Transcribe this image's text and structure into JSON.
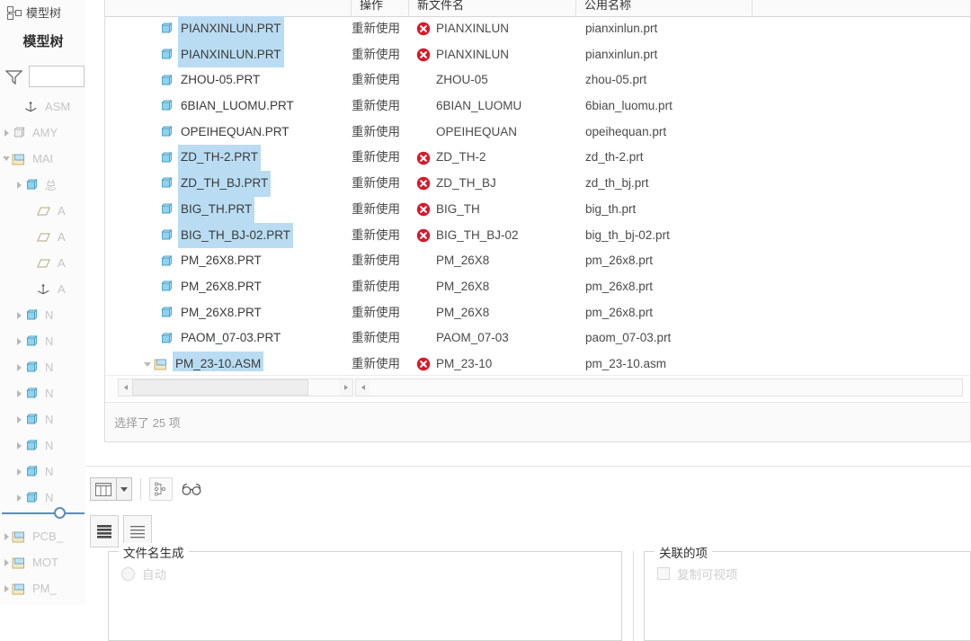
{
  "left_panel": {
    "tab_label": "模型树",
    "panel_title": "模型树",
    "filter_placeholder": "",
    "filter_value": "",
    "filter_icon": "funnel-icon",
    "tree_items": [
      {
        "label": "ASM",
        "icon": "csys-icon",
        "indent": 2,
        "toggle": "none"
      },
      {
        "label": "AMY",
        "icon": "part-grey-icon",
        "indent": 1,
        "toggle": "right"
      },
      {
        "label": "MAI",
        "icon": "assembly-icon",
        "indent": 1,
        "toggle": "down"
      },
      {
        "label": "总",
        "icon": "assembly-blue-icon",
        "indent": 2,
        "toggle": "right"
      },
      {
        "label": "A",
        "icon": "plane-icon",
        "indent": 3,
        "toggle": "none"
      },
      {
        "label": "A",
        "icon": "plane-icon",
        "indent": 3,
        "toggle": "none"
      },
      {
        "label": "A",
        "icon": "plane-icon",
        "indent": 3,
        "toggle": "none"
      },
      {
        "label": "A",
        "icon": "csys-icon",
        "indent": 3,
        "toggle": "none"
      },
      {
        "label": "N",
        "icon": "part-blue-icon",
        "indent": 2,
        "toggle": "right"
      },
      {
        "label": "N",
        "icon": "part-blue-icon",
        "indent": 2,
        "toggle": "right"
      },
      {
        "label": "N",
        "icon": "part-blue-icon",
        "indent": 2,
        "toggle": "right"
      },
      {
        "label": "N",
        "icon": "part-blue-icon",
        "indent": 2,
        "toggle": "right"
      },
      {
        "label": "N",
        "icon": "part-blue-icon",
        "indent": 2,
        "toggle": "right"
      },
      {
        "label": "N",
        "icon": "part-blue-icon",
        "indent": 2,
        "toggle": "right"
      },
      {
        "label": "N",
        "icon": "part-blue-icon",
        "indent": 2,
        "toggle": "right"
      },
      {
        "label": "N",
        "icon": "part-blue-icon",
        "indent": 2,
        "toggle": "right"
      }
    ],
    "tree_items_below": [
      {
        "label": "PCB_",
        "icon": "assembly-icon",
        "indent": 1,
        "toggle": "right"
      },
      {
        "label": "MOT",
        "icon": "assembly-icon",
        "indent": 1,
        "toggle": "right"
      },
      {
        "label": "PM_",
        "icon": "assembly-icon",
        "indent": 1,
        "toggle": "right"
      }
    ]
  },
  "table": {
    "columns": [
      {
        "key": "file",
        "label": ""
      },
      {
        "key": "op",
        "label": "操作"
      },
      {
        "key": "newname",
        "label": "新文件名"
      },
      {
        "key": "pubname",
        "label": "公用名称"
      }
    ],
    "rows": [
      {
        "file": "PIANXINLUN.PRT",
        "icon": "part-icon",
        "selected": true,
        "op": "重新使用",
        "newname": "PIANXINLUN",
        "error": true,
        "pubname": "pianxinlun.prt",
        "expand": ""
      },
      {
        "file": "PIANXINLUN.PRT",
        "icon": "part-icon",
        "selected": true,
        "op": "重新使用",
        "newname": "PIANXINLUN",
        "error": true,
        "pubname": "pianxinlun.prt",
        "expand": ""
      },
      {
        "file": "ZHOU-05.PRT",
        "icon": "part-icon",
        "selected": false,
        "op": "重新使用",
        "newname": "ZHOU-05",
        "error": false,
        "pubname": "zhou-05.prt",
        "expand": ""
      },
      {
        "file": "6BIAN_LUOMU.PRT",
        "icon": "part-icon",
        "selected": false,
        "op": "重新使用",
        "newname": "6BIAN_LUOMU",
        "error": false,
        "pubname": "6bian_luomu.prt",
        "expand": ""
      },
      {
        "file": "OPEIHEQUAN.PRT",
        "icon": "part-icon",
        "selected": false,
        "op": "重新使用",
        "newname": "OPEIHEQUAN",
        "error": false,
        "pubname": "opeihequan.prt",
        "expand": ""
      },
      {
        "file": "ZD_TH-2.PRT",
        "icon": "part-icon",
        "selected": true,
        "op": "重新使用",
        "newname": "ZD_TH-2",
        "error": true,
        "pubname": "zd_th-2.prt",
        "expand": ""
      },
      {
        "file": "ZD_TH_BJ.PRT",
        "icon": "part-icon",
        "selected": true,
        "op": "重新使用",
        "newname": "ZD_TH_BJ",
        "error": true,
        "pubname": "zd_th_bj.prt",
        "expand": ""
      },
      {
        "file": "BIG_TH.PRT",
        "icon": "part-icon",
        "selected": true,
        "op": "重新使用",
        "newname": "BIG_TH",
        "error": true,
        "pubname": "big_th.prt",
        "expand": ""
      },
      {
        "file": "BIG_TH_BJ-02.PRT",
        "icon": "part-icon",
        "selected": true,
        "op": "重新使用",
        "newname": "BIG_TH_BJ-02",
        "error": true,
        "pubname": "big_th_bj-02.prt",
        "expand": ""
      },
      {
        "file": "PM_26X8.PRT",
        "icon": "part-icon",
        "selected": false,
        "op": "重新使用",
        "newname": "PM_26X8",
        "error": false,
        "pubname": "pm_26x8.prt",
        "expand": ""
      },
      {
        "file": "PM_26X8.PRT",
        "icon": "part-icon",
        "selected": false,
        "op": "重新使用",
        "newname": "PM_26X8",
        "error": false,
        "pubname": "pm_26x8.prt",
        "expand": ""
      },
      {
        "file": "PM_26X8.PRT",
        "icon": "part-icon",
        "selected": false,
        "op": "重新使用",
        "newname": "PM_26X8",
        "error": false,
        "pubname": "pm_26x8.prt",
        "expand": ""
      },
      {
        "file": "PAOM_07-03.PRT",
        "icon": "part-icon",
        "selected": false,
        "op": "重新使用",
        "newname": "PAOM_07-03",
        "error": false,
        "pubname": "paom_07-03.prt",
        "expand": ""
      },
      {
        "file": "PM_23-10.ASM",
        "icon": "assembly-icon",
        "selected": true,
        "op": "重新使用",
        "newname": "PM_23-10",
        "error": true,
        "pubname": "pm_23-10.asm",
        "expand": "down"
      }
    ],
    "status_text": "选择了 25 项"
  },
  "toolbar": {
    "split_view_button": "split-view-icon",
    "split_view_caret": "chevron-down-icon",
    "structure_button": "structure-tree-icon",
    "preview_button": "glasses-icon",
    "list_dense_button": "list-dense-icon",
    "list_sparse_button": "list-sparse-icon"
  },
  "bottom_panels": {
    "filename_generation": {
      "legend": "文件名生成",
      "option_auto": "自动"
    },
    "related_items": {
      "legend": "关联的项",
      "option_copy_visible": "复制可视项"
    }
  },
  "colors": {
    "selection_blue": "#b9dcf2",
    "error_red": "#d9182a",
    "part_cyan": "#8fd3ef",
    "slider_blue": "#5b8db8"
  }
}
